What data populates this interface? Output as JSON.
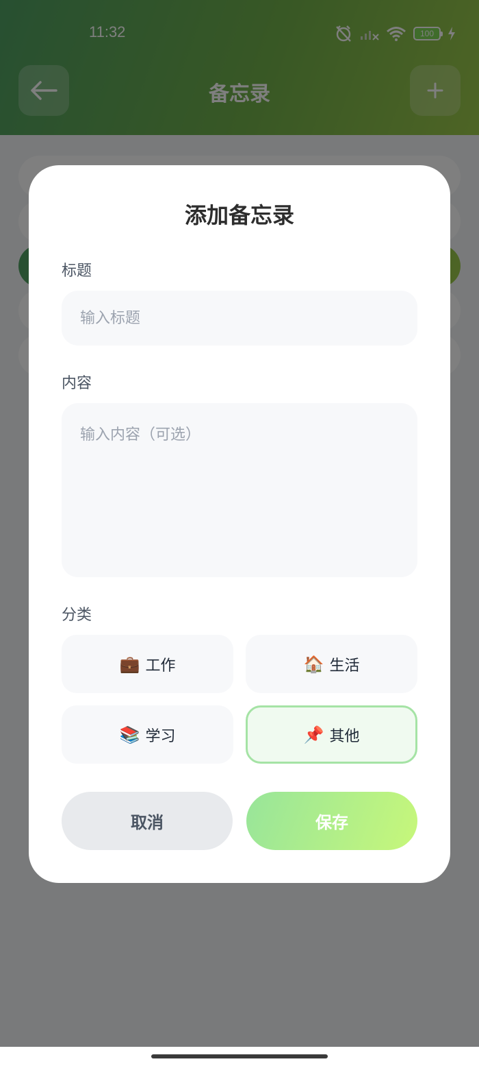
{
  "status_bar": {
    "time": "11:32",
    "battery": "100"
  },
  "header": {
    "title": "备忘录",
    "back_icon": "arrow-left-icon",
    "add_icon": "plus-icon"
  },
  "modal": {
    "title": "添加备忘录",
    "title_field": {
      "label": "标题",
      "placeholder": "输入标题",
      "value": ""
    },
    "content_field": {
      "label": "内容",
      "placeholder": "输入内容（可选）",
      "value": ""
    },
    "category": {
      "label": "分类",
      "options": [
        {
          "emoji": "💼",
          "label": "工作",
          "selected": false
        },
        {
          "emoji": "🏠",
          "label": "生活",
          "selected": false
        },
        {
          "emoji": "📚",
          "label": "学习",
          "selected": false
        },
        {
          "emoji": "📌",
          "label": "其他",
          "selected": true
        }
      ]
    },
    "cancel_label": "取消",
    "save_label": "保存"
  },
  "colors": {
    "accent_gradient_start": "#4fa063",
    "accent_gradient_end": "#9cc94a",
    "save_gradient_start": "#98e59a",
    "save_gradient_end": "#c7f77a",
    "selected_border": "#a5e3a5"
  }
}
